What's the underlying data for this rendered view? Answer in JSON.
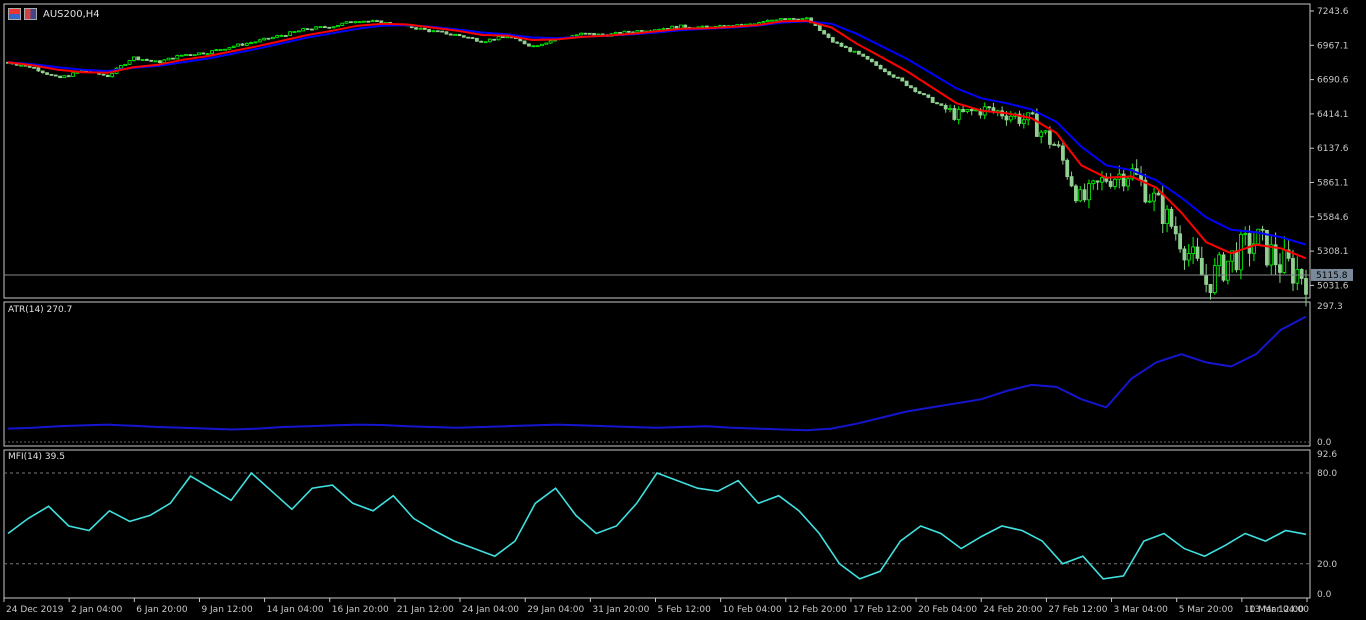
{
  "window": {
    "symbol_title": "AUS200,H4",
    "icons": [
      "chart-window-icon",
      "chart-properties-icon"
    ]
  },
  "colors": {
    "background": "#000000",
    "grid_axis": "#c8c8c8",
    "candle_bull": "#00ff00",
    "candle_bear": "#90d090",
    "ma_fast": "#ff0000",
    "ma_slow": "#0000ff",
    "atr_line": "#1515d0",
    "mfi_line": "#40e0e0",
    "price_line": "#8a8a8a",
    "price_label_bg": "#7a8a9a"
  },
  "time_axis": {
    "labels": [
      "24 Dec 2019",
      "2 Jan 04:00",
      "6 Jan 20:00",
      "9 Jan 12:00",
      "14 Jan 04:00",
      "16 Jan 20:00",
      "21 Jan 12:00",
      "24 Jan 04:00",
      "29 Jan 04:00",
      "31 Jan 20:00",
      "5 Feb 12:00",
      "10 Feb 04:00",
      "12 Feb 20:00",
      "17 Feb 12:00",
      "20 Feb 04:00",
      "24 Feb 20:00",
      "27 Feb 12:00",
      "3 Mar 04:00",
      "5 Mar 20:00",
      "10 Mar 12:00",
      "13 Mar 04:00"
    ]
  },
  "chart_data": [
    {
      "type": "line",
      "name": "price-pane",
      "title": "AUS200,H4",
      "y_ticks": [
        "7243.6",
        "6967.1",
        "6690.6",
        "6414.1",
        "6137.6",
        "5861.1",
        "5584.6",
        "5308.1",
        "5031.6"
      ],
      "ylim": [
        4930,
        7300
      ],
      "current_price_label": "5115.8",
      "current_price": 5115.8,
      "x_ticks": [
        "24 Dec 2019",
        "2 Jan 04:00",
        "6 Jan 20:00",
        "9 Jan 12:00",
        "14 Jan 04:00",
        "16 Jan 20:00",
        "21 Jan 12:00",
        "24 Jan 04:00",
        "29 Jan 04:00",
        "31 Jan 20:00",
        "5 Feb 12:00",
        "10 Feb 04:00",
        "12 Feb 20:00",
        "17 Feb 12:00",
        "20 Feb 04:00",
        "24 Feb 20:00",
        "27 Feb 12:00",
        "3 Mar 04:00",
        "5 Mar 20:00",
        "10 Mar 12:00",
        "13 Mar 04:00"
      ],
      "price_close_profile": [
        6830,
        6790,
        6700,
        6760,
        6720,
        6870,
        6830,
        6890,
        6910,
        6960,
        7000,
        7050,
        7100,
        7120,
        7170,
        7150,
        7120,
        7080,
        7050,
        7000,
        7040,
        6960,
        7020,
        7060,
        7050,
        7080,
        7100,
        7120,
        7110,
        7120,
        7140,
        7190,
        7180,
        7000,
        6900,
        6780,
        6650,
        6520,
        6400,
        6450,
        6420,
        6350,
        6150,
        5700,
        5900,
        5950,
        5700,
        5400,
        5050,
        5250,
        5400,
        5200,
        5115.8
      ],
      "series": [
        {
          "name": "ma-fast",
          "values": [
            6830,
            6805,
            6770,
            6750,
            6745,
            6790,
            6810,
            6850,
            6880,
            6920,
            6960,
            7005,
            7050,
            7085,
            7125,
            7140,
            7135,
            7110,
            7085,
            7050,
            7045,
            7010,
            7015,
            7035,
            7045,
            7060,
            7080,
            7100,
            7105,
            7115,
            7130,
            7160,
            7165,
            7110,
            6980,
            6870,
            6760,
            6630,
            6500,
            6440,
            6420,
            6380,
            6260,
            6000,
            5900,
            5910,
            5820,
            5620,
            5380,
            5290,
            5360,
            5330,
            5250
          ]
        },
        {
          "name": "ma-slow",
          "values": [
            6830,
            6815,
            6790,
            6770,
            6760,
            6785,
            6800,
            6830,
            6860,
            6900,
            6940,
            6985,
            7030,
            7065,
            7100,
            7125,
            7130,
            7115,
            7095,
            7070,
            7055,
            7030,
            7025,
            7035,
            7045,
            7055,
            7070,
            7090,
            7100,
            7110,
            7125,
            7150,
            7160,
            7140,
            7060,
            6960,
            6860,
            6740,
            6620,
            6540,
            6500,
            6450,
            6350,
            6150,
            6000,
            5960,
            5880,
            5740,
            5580,
            5480,
            5460,
            5420,
            5360
          ]
        }
      ]
    },
    {
      "type": "line",
      "name": "atr-pane",
      "label": "ATR(14) 270.7",
      "y_ticks": [
        "297.3",
        "0.0"
      ],
      "ylim": [
        0,
        297.3
      ],
      "series": [
        {
          "name": "ATR(14)",
          "values": [
            18,
            20,
            24,
            26,
            28,
            25,
            22,
            20,
            18,
            16,
            18,
            22,
            24,
            26,
            28,
            27,
            24,
            22,
            20,
            22,
            24,
            26,
            28,
            26,
            24,
            22,
            20,
            22,
            24,
            20,
            18,
            16,
            14,
            18,
            30,
            45,
            60,
            70,
            80,
            90,
            110,
            125,
            120,
            90,
            70,
            140,
            180,
            200,
            180,
            170,
            200,
            260,
            292
          ]
        }
      ]
    },
    {
      "type": "line",
      "name": "mfi-pane",
      "label": "MFI(14) 39.5",
      "y_ticks": [
        "92.6",
        "80.0",
        "20.0",
        "0.0"
      ],
      "ylim": [
        0,
        92.6
      ],
      "levels": [
        80,
        20
      ],
      "series": [
        {
          "name": "MFI(14)",
          "values": [
            40,
            50,
            58,
            45,
            42,
            55,
            48,
            52,
            60,
            78,
            70,
            62,
            80,
            68,
            56,
            70,
            72,
            60,
            55,
            65,
            50,
            42,
            35,
            30,
            25,
            35,
            60,
            70,
            52,
            40,
            45,
            60,
            80,
            75,
            70,
            68,
            75,
            60,
            65,
            55,
            40,
            20,
            10,
            15,
            35,
            45,
            40,
            30,
            38,
            45,
            42,
            35,
            20,
            25,
            10,
            12,
            35,
            40,
            30,
            25,
            32,
            40,
            35,
            42,
            39.5
          ]
        }
      ]
    }
  ]
}
